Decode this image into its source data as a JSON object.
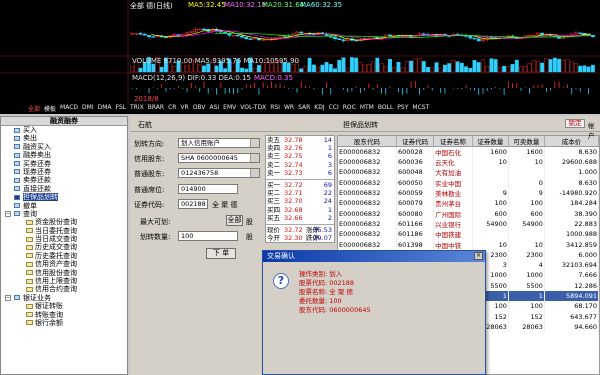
{
  "chart": {
    "title_row": "全部 德(日线)",
    "ma5": "MA5:32.45",
    "ma10": "MA10:32.18",
    "ma20": "MA20:31.64",
    "ma60": "MA60:32.35",
    "volume_row": "VOLUME 6710.00  MA5:9395.75  MA10:10595.90",
    "macd_row": "MACD(12,26,9)  DIF:0.33  DEA:0.15",
    "macd_val": "MACD:0.35",
    "date_label": "2018/8",
    "colors": {
      "price": "#ffffff",
      "ma5": "#ffff00",
      "ma10": "#ff00ff",
      "ma20": "#00ff00",
      "ma60": "#00ffff",
      "up": "#ff3030",
      "down": "#30d0ff"
    }
  },
  "indicator_tabs": [
    "全部",
    "模板",
    "MACD",
    "DMI",
    "DMA",
    "FSL",
    "TRIX",
    "BRAR",
    "CR",
    "VR",
    "OBV",
    "ASI",
    "EMV",
    "VOL-TDX",
    "RSI",
    "WR",
    "SAR",
    "KDJ",
    "CCI",
    "ROC",
    "MTM",
    "BOLL",
    "PSY",
    "MCST"
  ],
  "tree": {
    "header": "融资融券",
    "items": [
      {
        "label": "买入",
        "level": 1
      },
      {
        "label": "卖出",
        "level": 1
      },
      {
        "label": "融资买入",
        "level": 1
      },
      {
        "label": "融券卖出",
        "level": 1
      },
      {
        "label": "买券还券",
        "level": 1
      },
      {
        "label": "现券还券",
        "level": 1
      },
      {
        "label": "卖券还款",
        "level": 1
      },
      {
        "label": "直接还款",
        "level": 1
      },
      {
        "label": "担保品划转",
        "level": 1,
        "selected": true
      },
      {
        "label": "撤单",
        "level": 1
      },
      {
        "label": "查询",
        "level": 1
      },
      {
        "label": "资金股份查询",
        "level": 2
      },
      {
        "label": "当日委托查询",
        "level": 2
      },
      {
        "label": "当日成交查询",
        "level": 2
      },
      {
        "label": "历史成交查询",
        "level": 2
      },
      {
        "label": "历史委托查询",
        "level": 2
      },
      {
        "label": "信用资产查询",
        "level": 2
      },
      {
        "label": "信用股份查询",
        "level": 2
      },
      {
        "label": "信用上限查询",
        "level": 2
      },
      {
        "label": "信用合约查询",
        "level": 2
      },
      {
        "label": "银证业务",
        "level": 1
      },
      {
        "label": "银证转账",
        "level": 2
      },
      {
        "label": "转账查询",
        "level": 2
      },
      {
        "label": "银行余额",
        "level": 2
      }
    ]
  },
  "order": {
    "header_label": "石航",
    "transfer_label": "划转方向:",
    "transfer_value": "划入信用账户",
    "credit_acct_label": "信用股东:",
    "credit_acct_value": "SHA 0600000645",
    "normal_acct_label": "普通股东:",
    "normal_acct_value": "012436758",
    "normal_seat_label": "普通席位:",
    "normal_seat_value": "014900",
    "code_label": "证券代码:",
    "code_value": "002188",
    "name_value": "全 聚 德",
    "max_label": "最大可划:",
    "all_btn": "全部",
    "unit": "股",
    "qty_label": "划转数量:",
    "qty_value": "100",
    "submit_btn": "下 单"
  },
  "quotes": {
    "sells": [
      {
        "label": "卖五",
        "price": "32.78",
        "vol": "14"
      },
      {
        "label": "卖四",
        "price": "32.76",
        "vol": "1"
      },
      {
        "label": "卖三",
        "price": "32.75",
        "vol": "6"
      },
      {
        "label": "卖二",
        "price": "32.74",
        "vol": "3"
      },
      {
        "label": "卖一",
        "price": "32.73",
        "vol": "6"
      }
    ],
    "buys": [
      {
        "label": "买一",
        "price": "32.72",
        "vol": "69"
      },
      {
        "label": "买二",
        "price": "32.71",
        "vol": "22"
      },
      {
        "label": "买三",
        "price": "32.70",
        "vol": "24"
      },
      {
        "label": "买四",
        "price": "32.68",
        "vol": "1"
      },
      {
        "label": "买五",
        "price": "32.66",
        "vol": "2"
      }
    ],
    "last_label": "现价",
    "last_value": "32.72",
    "change_label": "涨停",
    "change_value": "35.53",
    "open_label": "今开",
    "open_value": "32.30",
    "limit_down_label": "跌停",
    "limit_down_value": "29.07"
  },
  "grid": {
    "title": "担保品划转",
    "status": "锁定",
    "status2": "帐户",
    "columns": [
      "股东代码",
      "证券代码",
      "证券名称",
      "证券数量",
      "可卖数量",
      "成本价"
    ],
    "rows": [
      [
        "E000006832",
        "600028",
        "中国石化",
        "1600",
        "1600",
        "8.630"
      ],
      [
        "E000006832",
        "600036",
        "云天化",
        "10",
        "10",
        "29600.688"
      ],
      [
        "E000006832",
        "600048",
        "大有加油",
        "",
        "",
        "1.000"
      ],
      [
        "E000006832",
        "600050",
        "实业中国",
        "",
        "0",
        "8.630"
      ],
      [
        "E000006832",
        "600059",
        "美林勘业",
        "9",
        "9",
        "-14980.920"
      ],
      [
        "E000006832",
        "600079",
        "贵州茅台",
        "100",
        "100",
        "184.284"
      ],
      [
        "E000006832",
        "600080",
        "广州国际",
        "600",
        "600",
        "38.390"
      ],
      [
        "E000006832",
        "601166",
        "兴业银行",
        "54900",
        "54900",
        "22.883"
      ],
      [
        "E000006832",
        "601186",
        "中国铁建",
        "",
        "",
        "1000.988"
      ],
      [
        "E000006832",
        "601398",
        "中国中铁",
        "10",
        "10",
        "3412.859"
      ],
      [
        "E000006832",
        "601668",
        "中国建筑",
        "2300",
        "2300",
        "6.000"
      ],
      [
        "",
        "",
        "",
        "3",
        "4",
        "32103.694"
      ],
      [
        "",
        "",
        "",
        "1000",
        "1000",
        "7.666"
      ],
      [
        "",
        "",
        "",
        "5500",
        "5500",
        "12.286"
      ],
      [
        "",
        "",
        "",
        "1",
        "1",
        "5894.091"
      ],
      [
        "",
        "",
        "",
        "100",
        "100",
        "68.170"
      ],
      [
        "",
        "",
        "",
        "152",
        "152",
        "643.677"
      ],
      [
        "",
        "",
        "",
        "28063",
        "28063",
        "94.660"
      ]
    ],
    "highlight_row": 14
  },
  "dialog": {
    "title": "交易确认",
    "close": "×",
    "lines": [
      "操作类别:  划入",
      "股票代码:  002188",
      "股票名称:  全 聚 德",
      "委托数量:  100",
      "股东代码:  0600000645"
    ]
  }
}
